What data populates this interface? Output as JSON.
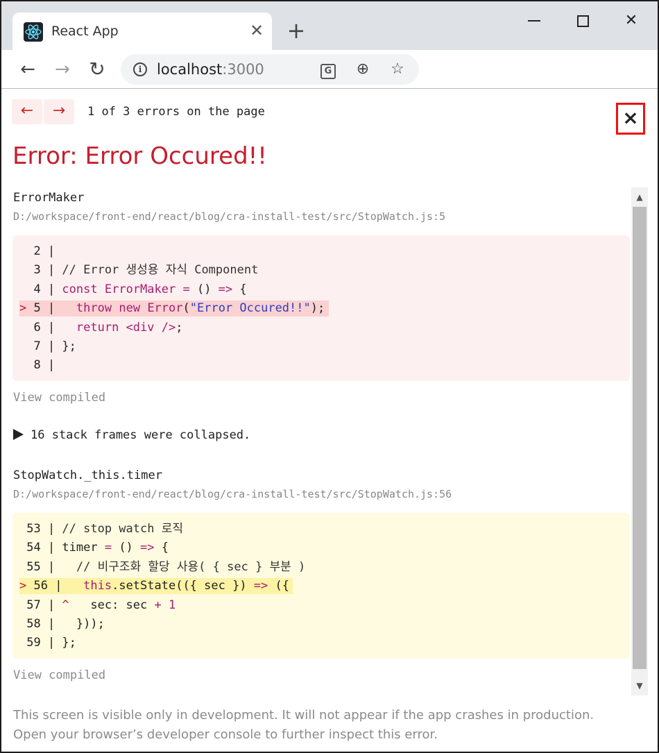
{
  "browser": {
    "tab_title": "React App",
    "tab_close": "✕",
    "new_tab": "+",
    "url_host": "localhost",
    "url_port": ":3000",
    "back_glyph": "←",
    "forward_glyph": "→",
    "reload_glyph": "↻",
    "zoom_glyph": "⊕",
    "star_glyph": "☆",
    "translate_glyph": "G",
    "close_glyph": "✕"
  },
  "overlay": {
    "prev_glyph": "←",
    "next_glyph": "→",
    "error_count": "1 of 3 errors on the page",
    "close_glyph": "×",
    "title": "Error: Error Occured!!",
    "frames": [
      {
        "function": "ErrorMaker",
        "path": "D:/workspace/front-end/react/blog/cra-install-test/src/StopWatch.js:5",
        "view_compiled": "View compiled"
      },
      {
        "function": "StopWatch._this.timer",
        "path": "D:/workspace/front-end/react/blog/cra-install-test/src/StopWatch.js:56",
        "view_compiled": "View compiled"
      }
    ],
    "collapsed_text": "16 stack frames were collapsed.",
    "footer_line1": "This screen is visible only in development. It will not appear if the app crashes in production.",
    "footer_line2": "Open your browser’s developer console to further inspect this error."
  },
  "icons": [
    "react-logo-icon",
    "info-icon",
    "translate-icon",
    "zoom-icon",
    "star-icon",
    "scroll-up-icon",
    "scroll-down-icon",
    "expand-triangle-icon"
  ],
  "colors": {
    "error_red": "#c81d2d",
    "code_red_bg": "#fdf0f0",
    "code_red_highlight": "#fbd1d1",
    "code_yellow_bg": "#fffbe0",
    "code_yellow_highlight": "#fdf3a5",
    "close_highlight": "#ee1111"
  }
}
